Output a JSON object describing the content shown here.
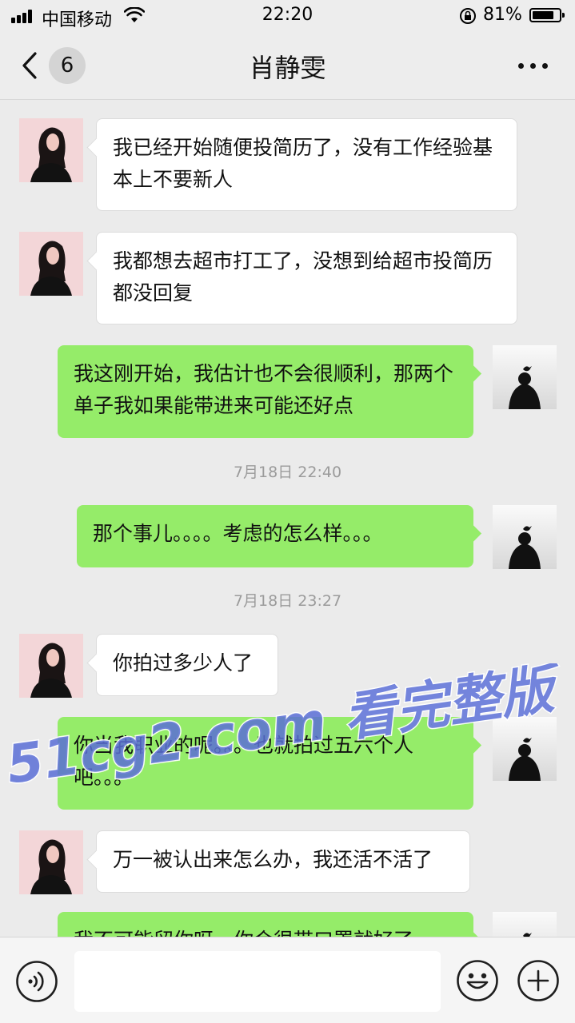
{
  "status_bar": {
    "carrier": "中国移动",
    "time": "22:20",
    "battery": "81%",
    "battery_level": 0.81
  },
  "nav": {
    "back_count": "6",
    "title": "肖静雯"
  },
  "messages": [
    {
      "side": "in",
      "text": "我已经开始随便投简历了，没有工作经验基本上不要新人"
    },
    {
      "side": "in",
      "text": "我都想去超市打工了，没想到给超市投简历都没回复"
    },
    {
      "side": "out",
      "text": "我这刚开始，我估计也不会很顺利，那两个单子我如果能带进来可能还好点"
    },
    {
      "side": "out",
      "text": "那个事儿。。。。考虑的怎么样。。。"
    },
    {
      "side": "in",
      "text": "你拍过多少人了"
    },
    {
      "side": "out",
      "text": "你当我职业的呢。。。也就拍过五六个人吧。。。"
    },
    {
      "side": "in",
      "text": "万一被认出来怎么办，我还活不活了"
    },
    {
      "side": "out",
      "text": "我不可能留你呀，你会很带口罩就好了"
    }
  ],
  "timestamps": [
    "7月18日 22:40",
    "7月18日 23:27"
  ],
  "watermark": "51cg2.com 看完整版",
  "colors": {
    "outgoing_bubble": "#95ec69",
    "incoming_bubble": "#ffffff",
    "background": "#ebebeb",
    "watermark": "#5a6fd6"
  },
  "input_bar": {
    "icons": [
      "voice-icon",
      "emoji-icon",
      "plus-icon"
    ]
  }
}
